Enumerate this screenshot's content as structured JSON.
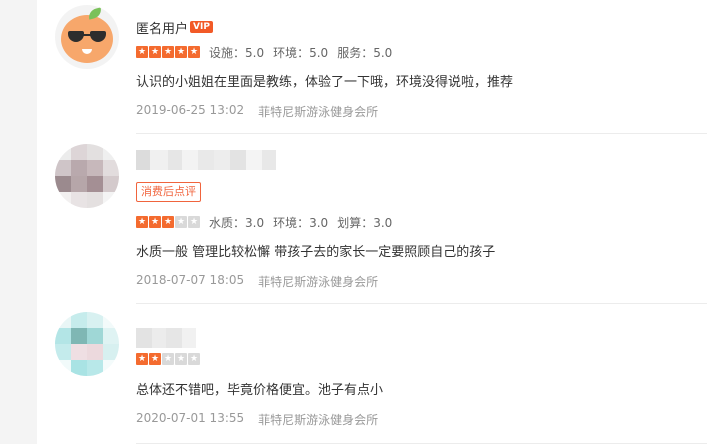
{
  "reviews": [
    {
      "user": "匿名用户",
      "vip_label": "VIP",
      "stars": 5,
      "scores": [
        "设施：5.0",
        "环境：5.0",
        "服务：5.0"
      ],
      "content": "认识的小姐姐在里面是教练，体验了一下哦，环境没得说啦，推荐",
      "date": "2019-06-25 13:02",
      "shop": "菲特尼斯游泳健身会所"
    },
    {
      "badge": "消费后点评",
      "stars": 3,
      "scores": [
        "水质：3.0",
        "环境：3.0",
        "划算：3.0"
      ],
      "content": "水质一般 管理比较松懈 带孩子去的家长一定要照顾自己的孩子",
      "date": "2018-07-07 18:05",
      "shop": "菲特尼斯游泳健身会所"
    },
    {
      "stars": 2,
      "content": "总体还不错吧，毕竟价格便宜。池子有点小",
      "date": "2020-07-01 13:55",
      "shop": "菲特尼斯游泳健身会所"
    }
  ],
  "colors": {
    "accent": "#f46b2f",
    "star_off": "#d9d9d9",
    "meta_text": "#999999"
  }
}
